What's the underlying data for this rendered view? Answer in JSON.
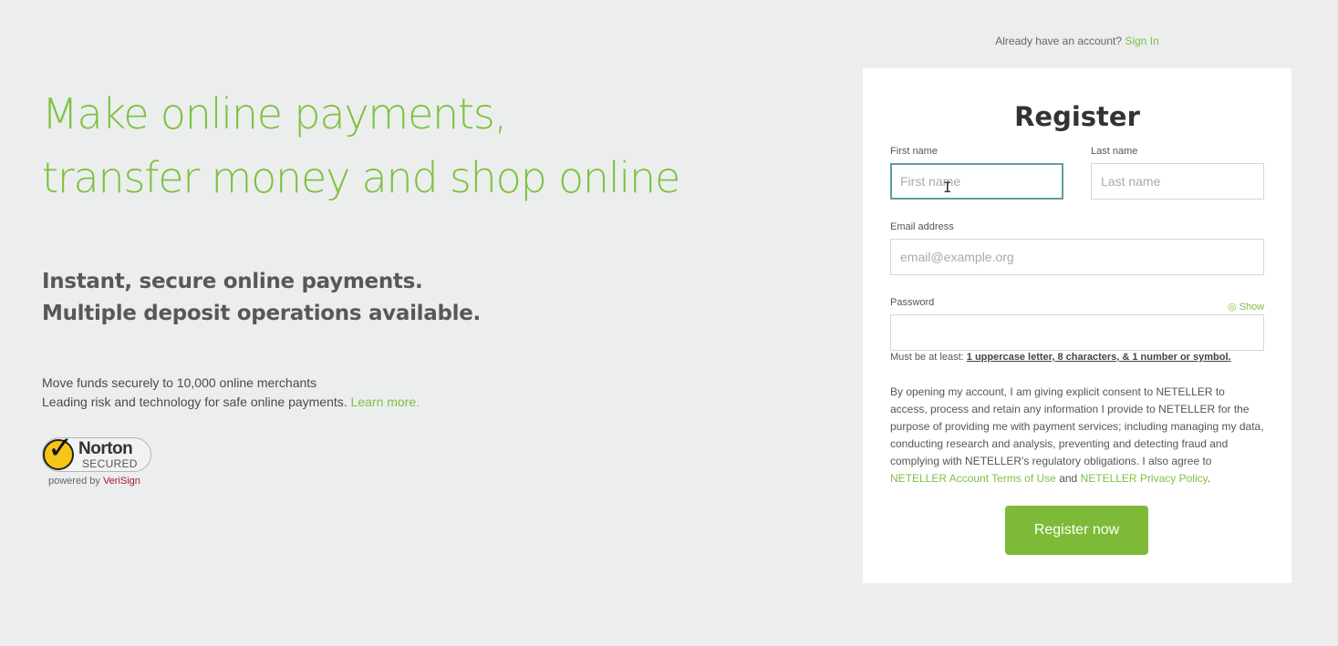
{
  "hero": {
    "headline_line1": "Make online payments,",
    "headline_line2": "transfer money and shop online",
    "subhead_line1": "Instant, secure online payments.",
    "subhead_line2": "Multiple deposit operations available.",
    "blurb_line1": "Move funds securely to 10,000 online merchants",
    "blurb_line2": "Leading risk and technology for safe online payments.",
    "learn_more": "Learn more."
  },
  "norton": {
    "title": "Norton",
    "secured": "SECURED",
    "powered_by": "powered by",
    "verisign": "VeriSign"
  },
  "signin": {
    "prompt": "Already have an account?",
    "link": "Sign In"
  },
  "form": {
    "title": "Register",
    "first_name_label": "First name",
    "first_name_placeholder": "First name",
    "last_name_label": "Last name",
    "last_name_placeholder": "Last name",
    "email_label": "Email address",
    "email_placeholder": "email@example.org",
    "password_label": "Password",
    "show_label": "Show",
    "pw_hint_prefix": "Must be at least:",
    "pw_hint_rules": "1 uppercase letter, 8 characters, & 1 number or symbol.",
    "consent_text": "By opening my account, I am giving explicit consent to NETELLER to access, process and retain any information I provide to NETELLER for the purpose of providing me with payment services; including managing my data, conducting research and analysis, preventing and detecting fraud and complying with NETELLER's regulatory obligations. I also agree to",
    "terms_link": "NETELLER Account Terms of Use",
    "and_word": "and",
    "privacy_link": "NETELLER Privacy Policy",
    "period": ".",
    "submit_label": "Register now"
  },
  "colors": {
    "accent": "#7dc142",
    "button": "#7dba37",
    "background": "#eceeed",
    "focus_border": "#5f9ea0"
  }
}
